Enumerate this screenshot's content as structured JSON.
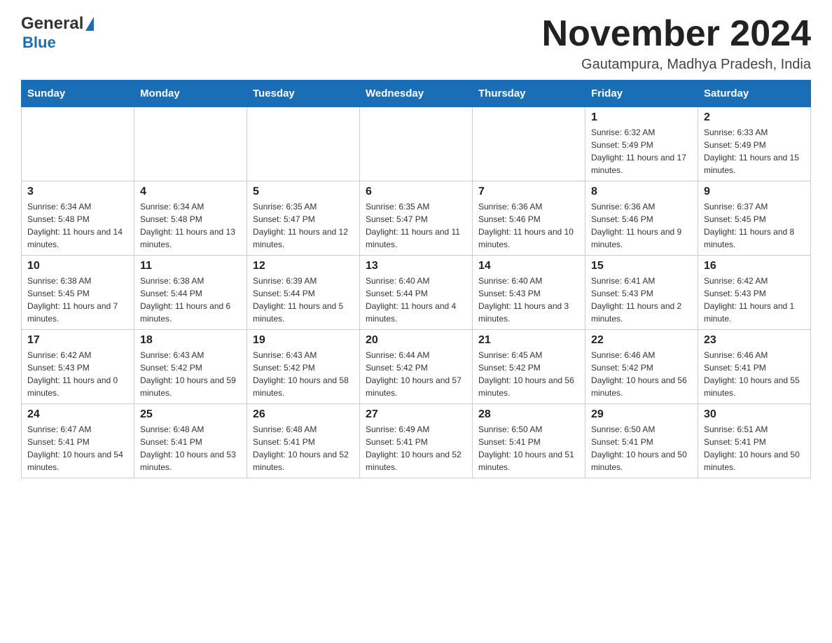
{
  "header": {
    "logo_general": "General",
    "logo_blue": "Blue",
    "month_title": "November 2024",
    "location": "Gautampura, Madhya Pradesh, India"
  },
  "days_of_week": [
    "Sunday",
    "Monday",
    "Tuesday",
    "Wednesday",
    "Thursday",
    "Friday",
    "Saturday"
  ],
  "weeks": [
    [
      {
        "day": "",
        "sunrise": "",
        "sunset": "",
        "daylight": ""
      },
      {
        "day": "",
        "sunrise": "",
        "sunset": "",
        "daylight": ""
      },
      {
        "day": "",
        "sunrise": "",
        "sunset": "",
        "daylight": ""
      },
      {
        "day": "",
        "sunrise": "",
        "sunset": "",
        "daylight": ""
      },
      {
        "day": "",
        "sunrise": "",
        "sunset": "",
        "daylight": ""
      },
      {
        "day": "1",
        "sunrise": "Sunrise: 6:32 AM",
        "sunset": "Sunset: 5:49 PM",
        "daylight": "Daylight: 11 hours and 17 minutes."
      },
      {
        "day": "2",
        "sunrise": "Sunrise: 6:33 AM",
        "sunset": "Sunset: 5:49 PM",
        "daylight": "Daylight: 11 hours and 15 minutes."
      }
    ],
    [
      {
        "day": "3",
        "sunrise": "Sunrise: 6:34 AM",
        "sunset": "Sunset: 5:48 PM",
        "daylight": "Daylight: 11 hours and 14 minutes."
      },
      {
        "day": "4",
        "sunrise": "Sunrise: 6:34 AM",
        "sunset": "Sunset: 5:48 PM",
        "daylight": "Daylight: 11 hours and 13 minutes."
      },
      {
        "day": "5",
        "sunrise": "Sunrise: 6:35 AM",
        "sunset": "Sunset: 5:47 PM",
        "daylight": "Daylight: 11 hours and 12 minutes."
      },
      {
        "day": "6",
        "sunrise": "Sunrise: 6:35 AM",
        "sunset": "Sunset: 5:47 PM",
        "daylight": "Daylight: 11 hours and 11 minutes."
      },
      {
        "day": "7",
        "sunrise": "Sunrise: 6:36 AM",
        "sunset": "Sunset: 5:46 PM",
        "daylight": "Daylight: 11 hours and 10 minutes."
      },
      {
        "day": "8",
        "sunrise": "Sunrise: 6:36 AM",
        "sunset": "Sunset: 5:46 PM",
        "daylight": "Daylight: 11 hours and 9 minutes."
      },
      {
        "day": "9",
        "sunrise": "Sunrise: 6:37 AM",
        "sunset": "Sunset: 5:45 PM",
        "daylight": "Daylight: 11 hours and 8 minutes."
      }
    ],
    [
      {
        "day": "10",
        "sunrise": "Sunrise: 6:38 AM",
        "sunset": "Sunset: 5:45 PM",
        "daylight": "Daylight: 11 hours and 7 minutes."
      },
      {
        "day": "11",
        "sunrise": "Sunrise: 6:38 AM",
        "sunset": "Sunset: 5:44 PM",
        "daylight": "Daylight: 11 hours and 6 minutes."
      },
      {
        "day": "12",
        "sunrise": "Sunrise: 6:39 AM",
        "sunset": "Sunset: 5:44 PM",
        "daylight": "Daylight: 11 hours and 5 minutes."
      },
      {
        "day": "13",
        "sunrise": "Sunrise: 6:40 AM",
        "sunset": "Sunset: 5:44 PM",
        "daylight": "Daylight: 11 hours and 4 minutes."
      },
      {
        "day": "14",
        "sunrise": "Sunrise: 6:40 AM",
        "sunset": "Sunset: 5:43 PM",
        "daylight": "Daylight: 11 hours and 3 minutes."
      },
      {
        "day": "15",
        "sunrise": "Sunrise: 6:41 AM",
        "sunset": "Sunset: 5:43 PM",
        "daylight": "Daylight: 11 hours and 2 minutes."
      },
      {
        "day": "16",
        "sunrise": "Sunrise: 6:42 AM",
        "sunset": "Sunset: 5:43 PM",
        "daylight": "Daylight: 11 hours and 1 minute."
      }
    ],
    [
      {
        "day": "17",
        "sunrise": "Sunrise: 6:42 AM",
        "sunset": "Sunset: 5:43 PM",
        "daylight": "Daylight: 11 hours and 0 minutes."
      },
      {
        "day": "18",
        "sunrise": "Sunrise: 6:43 AM",
        "sunset": "Sunset: 5:42 PM",
        "daylight": "Daylight: 10 hours and 59 minutes."
      },
      {
        "day": "19",
        "sunrise": "Sunrise: 6:43 AM",
        "sunset": "Sunset: 5:42 PM",
        "daylight": "Daylight: 10 hours and 58 minutes."
      },
      {
        "day": "20",
        "sunrise": "Sunrise: 6:44 AM",
        "sunset": "Sunset: 5:42 PM",
        "daylight": "Daylight: 10 hours and 57 minutes."
      },
      {
        "day": "21",
        "sunrise": "Sunrise: 6:45 AM",
        "sunset": "Sunset: 5:42 PM",
        "daylight": "Daylight: 10 hours and 56 minutes."
      },
      {
        "day": "22",
        "sunrise": "Sunrise: 6:46 AM",
        "sunset": "Sunset: 5:42 PM",
        "daylight": "Daylight: 10 hours and 56 minutes."
      },
      {
        "day": "23",
        "sunrise": "Sunrise: 6:46 AM",
        "sunset": "Sunset: 5:41 PM",
        "daylight": "Daylight: 10 hours and 55 minutes."
      }
    ],
    [
      {
        "day": "24",
        "sunrise": "Sunrise: 6:47 AM",
        "sunset": "Sunset: 5:41 PM",
        "daylight": "Daylight: 10 hours and 54 minutes."
      },
      {
        "day": "25",
        "sunrise": "Sunrise: 6:48 AM",
        "sunset": "Sunset: 5:41 PM",
        "daylight": "Daylight: 10 hours and 53 minutes."
      },
      {
        "day": "26",
        "sunrise": "Sunrise: 6:48 AM",
        "sunset": "Sunset: 5:41 PM",
        "daylight": "Daylight: 10 hours and 52 minutes."
      },
      {
        "day": "27",
        "sunrise": "Sunrise: 6:49 AM",
        "sunset": "Sunset: 5:41 PM",
        "daylight": "Daylight: 10 hours and 52 minutes."
      },
      {
        "day": "28",
        "sunrise": "Sunrise: 6:50 AM",
        "sunset": "Sunset: 5:41 PM",
        "daylight": "Daylight: 10 hours and 51 minutes."
      },
      {
        "day": "29",
        "sunrise": "Sunrise: 6:50 AM",
        "sunset": "Sunset: 5:41 PM",
        "daylight": "Daylight: 10 hours and 50 minutes."
      },
      {
        "day": "30",
        "sunrise": "Sunrise: 6:51 AM",
        "sunset": "Sunset: 5:41 PM",
        "daylight": "Daylight: 10 hours and 50 minutes."
      }
    ]
  ]
}
